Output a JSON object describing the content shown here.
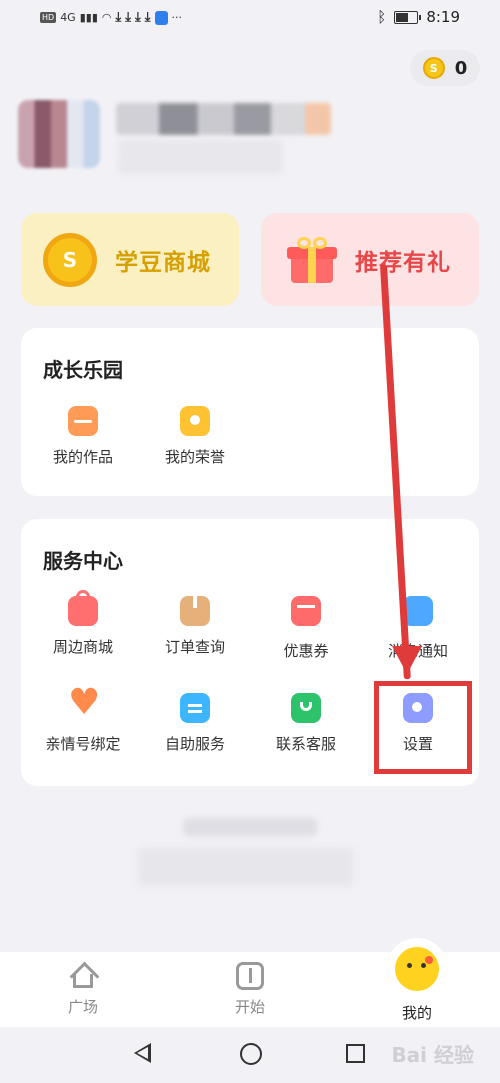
{
  "status_bar": {
    "network_badge": "HD",
    "network_type": "4G",
    "time": "8:19",
    "more": "···"
  },
  "header": {
    "coin_count": "0"
  },
  "promos": [
    {
      "label": "学豆商城",
      "icon": "coin-icon"
    },
    {
      "label": "推荐有礼",
      "icon": "gift-icon"
    }
  ],
  "growth_section": {
    "title": "成长乐园",
    "items": [
      {
        "label": "我的作品",
        "icon": "works-icon"
      },
      {
        "label": "我的荣誉",
        "icon": "honor-icon"
      }
    ]
  },
  "service_section": {
    "title": "服务中心",
    "items": [
      {
        "label": "周边商城",
        "icon": "shopping-bag-icon"
      },
      {
        "label": "订单查询",
        "icon": "package-icon"
      },
      {
        "label": "优惠券",
        "icon": "coupon-icon"
      },
      {
        "label": "消息通知",
        "icon": "envelope-icon"
      },
      {
        "label": "亲情号绑定",
        "icon": "heart-icon"
      },
      {
        "label": "自助服务",
        "icon": "clipboard-icon"
      },
      {
        "label": "联系客服",
        "icon": "chat-icon"
      },
      {
        "label": "设置",
        "icon": "settings-icon"
      }
    ]
  },
  "tab_bar": {
    "tabs": [
      {
        "label": "广场",
        "icon": "home-icon",
        "active": false
      },
      {
        "label": "开始",
        "icon": "start-icon",
        "active": false
      },
      {
        "label": "我的",
        "icon": "mascot-icon",
        "active": true
      }
    ]
  },
  "watermark": "Bai 经验",
  "colors": {
    "annotation_red": "#e03b3b",
    "coin_yellow": "#f7c21a",
    "promo_red": "#e8474a",
    "background": "#f2f2f6"
  }
}
